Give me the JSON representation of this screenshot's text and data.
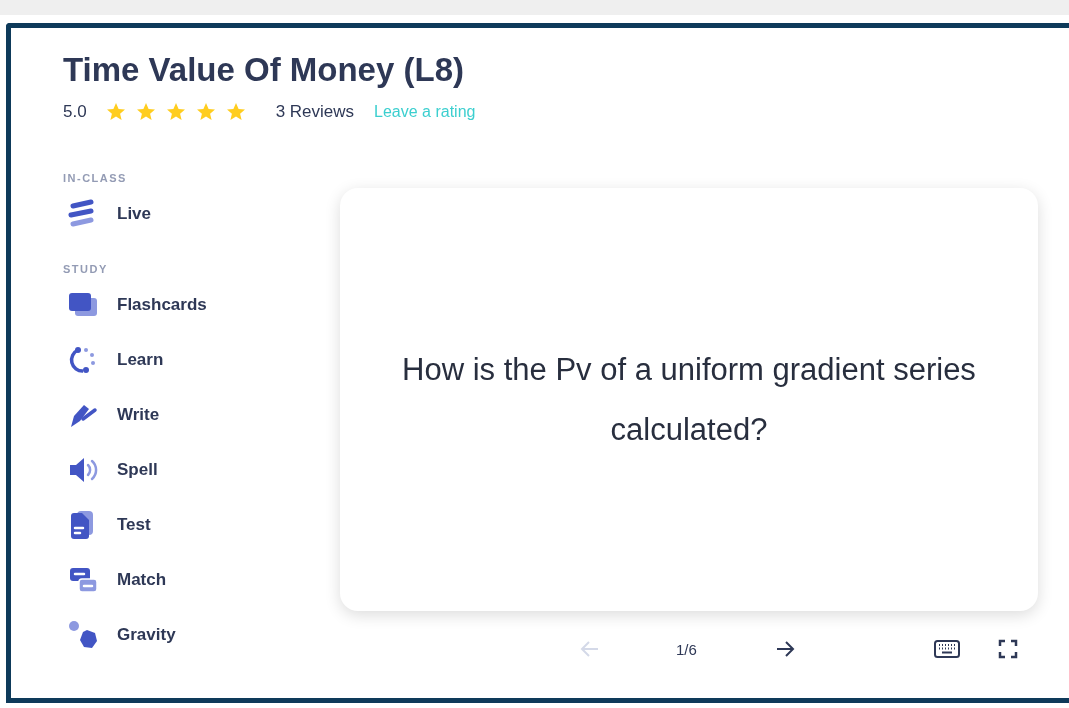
{
  "title": "Time Value Of Money (L8)",
  "rating": {
    "score": "5.0",
    "stars": 5,
    "reviews": "3 Reviews",
    "link": "Leave a rating"
  },
  "sidebar": [
    {
      "heading": "IN-CLASS",
      "items": [
        {
          "label": "Live",
          "kind": "live"
        }
      ]
    },
    {
      "heading": "STUDY",
      "items": [
        {
          "label": "Flashcards",
          "kind": "flashcards"
        },
        {
          "label": "Learn",
          "kind": "learn"
        },
        {
          "label": "Write",
          "kind": "write"
        },
        {
          "label": "Spell",
          "kind": "spell"
        },
        {
          "label": "Test",
          "kind": "test"
        },
        {
          "label": "Match",
          "kind": "match"
        },
        {
          "label": "Gravity",
          "kind": "gravity"
        }
      ]
    }
  ],
  "card": {
    "text": "How is the Pv of a uniform gradient series calculated?"
  },
  "nav": {
    "prev_disabled": true,
    "counter": "1/6",
    "next_disabled": false
  }
}
